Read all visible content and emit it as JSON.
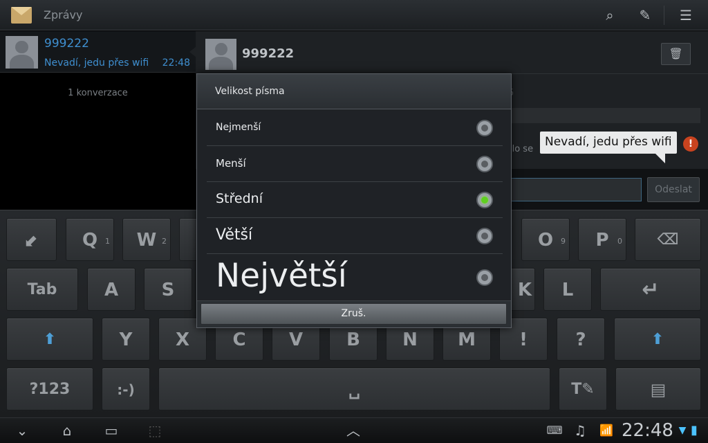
{
  "app": {
    "title": "Zprávy"
  },
  "actionbar": {
    "icons": [
      "search-icon",
      "compose-icon",
      "menu-icon"
    ]
  },
  "conversation_list": {
    "items": [
      {
        "name": "999222",
        "snippet": "Nevadí, jedu přes wifi",
        "time": "22:48"
      }
    ],
    "count_label": "1 konverzace"
  },
  "thread": {
    "contact_name": "999222",
    "faded_number": "5",
    "faded_text": "ilo se",
    "message": "Nevadí, jedu přes wifi",
    "error_icon": "!",
    "send_label": "Odeslat",
    "trash_icon": "🗑"
  },
  "dialog": {
    "title": "Velikost písma",
    "options": [
      {
        "label": "Nejmenší",
        "checked": false
      },
      {
        "label": "Menší",
        "checked": false
      },
      {
        "label": "Střední",
        "checked": true
      },
      {
        "label": "Větší",
        "checked": false
      },
      {
        "label": "Největší",
        "checked": false
      }
    ],
    "cancel_label": "Zruš."
  },
  "keyboard": {
    "row1": [
      {
        "label": "⬋",
        "sub": ""
      },
      {
        "label": "Q",
        "sub": "1"
      },
      {
        "label": "W",
        "sub": "2"
      },
      {
        "label": "O",
        "sub": "9"
      },
      {
        "label": "P",
        "sub": "0"
      },
      {
        "label": "⌫",
        "sub": ""
      }
    ],
    "row2": [
      {
        "label": "Tab"
      },
      {
        "label": "A"
      },
      {
        "label": "S"
      },
      {
        "label": "K"
      },
      {
        "label": "L"
      },
      {
        "label": "↵"
      }
    ],
    "row3": [
      {
        "label": "⬆"
      },
      {
        "label": "Y"
      },
      {
        "label": "X"
      },
      {
        "label": "C"
      },
      {
        "label": "V"
      },
      {
        "label": "B"
      },
      {
        "label": "N"
      },
      {
        "label": "M"
      },
      {
        "label": "!"
      },
      {
        "label": "?"
      },
      {
        "label": "⬆"
      }
    ],
    "row4": [
      {
        "label": "?123"
      },
      {
        "label": ":-)"
      },
      {
        "label": "␣"
      },
      {
        "label": "T✎"
      },
      {
        "label": "▤"
      }
    ]
  },
  "system_bar": {
    "clock": "22:48",
    "nav_icons": [
      "⌄",
      "⌂",
      "▭",
      "⬚"
    ],
    "up_icon": "︿",
    "status_icons": [
      "⌨",
      "♫",
      "📶",
      "▮"
    ]
  }
}
